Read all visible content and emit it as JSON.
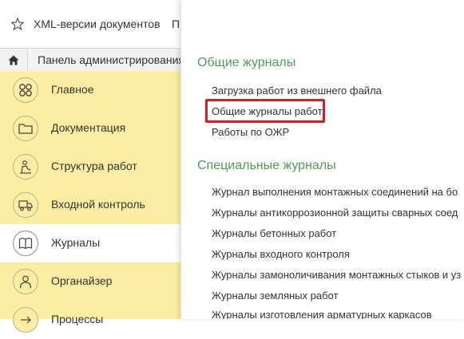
{
  "topbar": {
    "title": "XML-версии документов",
    "extra": "П",
    "star_icon": "star-icon"
  },
  "admin_bar": {
    "label": "Панель администрирования",
    "home_icon": "home-icon"
  },
  "sidebar": {
    "items": [
      {
        "label": "Главное",
        "icon": "grid-icon"
      },
      {
        "label": "Документация",
        "icon": "folder-icon"
      },
      {
        "label": "Структура работ",
        "icon": "worker-icon"
      },
      {
        "label": "Входной контроль",
        "icon": "truck-icon"
      },
      {
        "label": "Журналы",
        "icon": "book-icon",
        "active": true
      },
      {
        "label": "Органайзер",
        "icon": "person-icon"
      },
      {
        "label": "Процессы",
        "icon": "process-icon"
      }
    ]
  },
  "panel": {
    "general_title": "Общие журналы",
    "general_links": [
      "Загрузка работ из внешнего файла",
      "Общие журналы работ",
      "Работы по ОЖР"
    ],
    "special_title": "Специальные журналы",
    "special_links": [
      "Журнал выполнения монтажных соединений на бо",
      "Журналы антикоррозионной защиты сварных соед",
      "Журналы бетонных работ",
      "Журналы входного контроля",
      "Журналы замоноличивания монтажных стыков и уз",
      "Журналы земляных работ",
      "Журналы изготовления арматурных каркасов"
    ]
  },
  "colors": {
    "sidebar_bg": "#fbeea3",
    "section_title": "#4e9c58",
    "highlight_border": "#e0191b"
  }
}
